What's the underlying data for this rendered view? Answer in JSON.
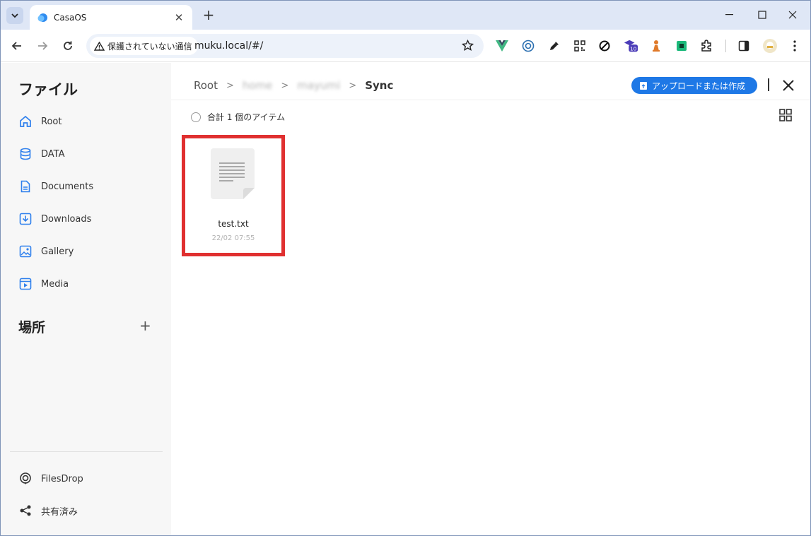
{
  "browser": {
    "tab_title": "CasaOS",
    "security_chip": "保護されていない通信",
    "url": "muku.local/#/",
    "ext_badge": "10"
  },
  "sidebar": {
    "title": "ファイル",
    "items": [
      {
        "label": "Root",
        "icon": "home-icon"
      },
      {
        "label": "DATA",
        "icon": "database-icon"
      },
      {
        "label": "Documents",
        "icon": "document-icon"
      },
      {
        "label": "Downloads",
        "icon": "download-icon"
      },
      {
        "label": "Gallery",
        "icon": "image-icon"
      },
      {
        "label": "Media",
        "icon": "media-icon"
      }
    ],
    "places_title": "場所",
    "bottom_items": [
      {
        "label": "FilesDrop",
        "icon": "filesdrop-icon"
      },
      {
        "label": "共有済み",
        "icon": "share-icon"
      }
    ]
  },
  "main": {
    "breadcrumb": [
      "Root",
      "home",
      "mayumi",
      "Sync"
    ],
    "upload_label": "アップロードまたは作成",
    "item_count": "合計 1 個のアイテム",
    "files": [
      {
        "name": "test.txt",
        "date": "22/02 07:55"
      }
    ]
  },
  "colors": {
    "accent": "#1e78e6",
    "highlight": "#e03030",
    "icon_blue": "#2f80ed"
  }
}
